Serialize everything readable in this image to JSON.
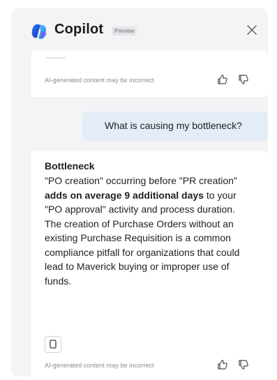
{
  "header": {
    "title": "Copilot",
    "badge": "Preview",
    "logo_icon": "copilot-logo-icon",
    "close_icon": "close-icon"
  },
  "messages": [
    {
      "role": "assistant",
      "disclaimer": "AI-generated content may be incorrect"
    },
    {
      "role": "user",
      "text": "What is causing my bottleneck?"
    },
    {
      "role": "assistant",
      "title": "Bottleneck",
      "body_parts": [
        {
          "text": "\"PO creation\" occurring before \"PR creation\" ",
          "bold": false
        },
        {
          "text": "adds on average 9 additional days",
          "bold": true
        },
        {
          "text": " to your \"PO approval\" activity and process duration. The creation of Purchase Orders without an existing Purchase Requisition is a common compliance pitfall for organizations that could lead to Maverick buying or improper use of funds.",
          "bold": false
        }
      ],
      "disclaimer": "AI-generated content may be incorrect"
    }
  ],
  "colors": {
    "pane_bg": "#f4f4f6",
    "user_bubble_bg": "#e3ecf7",
    "text": "#1f1f1f",
    "muted": "#8a8a8a"
  }
}
